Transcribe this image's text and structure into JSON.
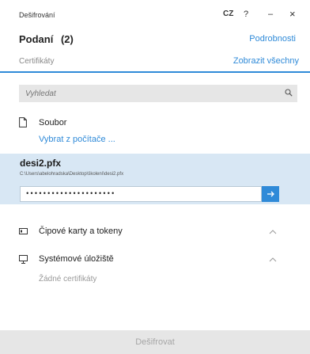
{
  "window": {
    "title": "Dešifrování",
    "lang": "CZ",
    "help_glyph": "?",
    "minimize_glyph": "–",
    "close_glyph": "×"
  },
  "header": {
    "title": "Podaní",
    "count": "(2)",
    "details_link": "Podrobnosti"
  },
  "certificates": {
    "label": "Certifikáty",
    "show_all_link": "Zobrazit všechny"
  },
  "search": {
    "placeholder": "Vyhledat",
    "icon": "search-icon"
  },
  "file_section": {
    "label": "Soubor",
    "pick_link": "Vybrat z počítače ...",
    "icon": "file-icon"
  },
  "selected_file": {
    "name": "desi2.pfx",
    "path": "C:\\Users\\abelohradska\\Desktop\\školení\\desi2.pfx",
    "password_masked": "•••••••••••••••••••••"
  },
  "groups": [
    {
      "label": "Čipové karty a tokeny",
      "icon": "card-icon",
      "expanded": true
    },
    {
      "label": "Systémové úložiště",
      "icon": "monitor-icon",
      "expanded": true,
      "empty_text": "Žádné certifikáty"
    }
  ],
  "footer": {
    "decrypt_button": "Dešifrovat"
  },
  "colors": {
    "accent": "#2f8ad8",
    "selected_bg": "#d8e7f4",
    "disabled_bg": "#e6e6e6",
    "disabled_text": "#a6a6a6"
  }
}
